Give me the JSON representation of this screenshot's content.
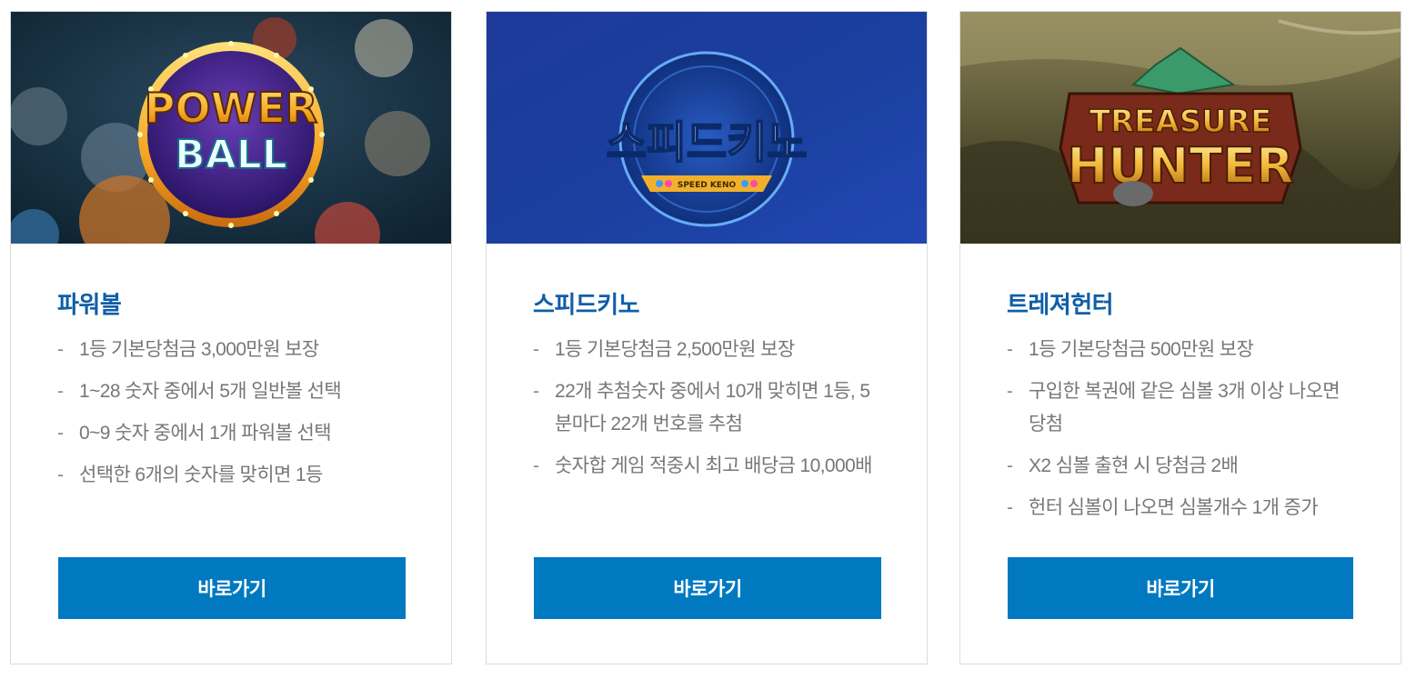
{
  "cards": [
    {
      "title": "파워볼",
      "logo": {
        "line1": "POWER",
        "line2": "BALL"
      },
      "features": [
        "1등 기본당첨금 3,000만원 보장",
        "1~28 숫자 중에서 5개 일반볼 선택",
        "0~9 숫자 중에서 1개 파워볼 선택",
        "선택한 6개의 숫자를 맞히면 1등"
      ],
      "button_label": "바로가기"
    },
    {
      "title": "스피드키노",
      "logo": {
        "main": "스피드키노",
        "sub": "SPEED KENO"
      },
      "features": [
        "1등 기본당첨금 2,500만원 보장",
        "22개 추첨숫자 중에서 10개 맞히면 1등, 5분마다 22개 번호를 추첨",
        "숫자합 게임 적중시 최고 배당금 10,000배"
      ],
      "button_label": "바로가기"
    },
    {
      "title": "트레져헌터",
      "logo": {
        "line1": "TREASURE",
        "line2": "HUNTER"
      },
      "features": [
        "1등 기본당첨금 500만원 보장",
        "구입한 복권에 같은 심볼 3개 이상 나오면 당첨",
        "X2 심볼 출현 시 당첨금 2배",
        "헌터 심볼이 나오면 심볼개수 1개 증가"
      ],
      "button_label": "바로가기"
    }
  ],
  "colors": {
    "accent": "#0079c1",
    "title": "#0f5ea8",
    "text": "#777777",
    "border": "#dcdcdc"
  }
}
